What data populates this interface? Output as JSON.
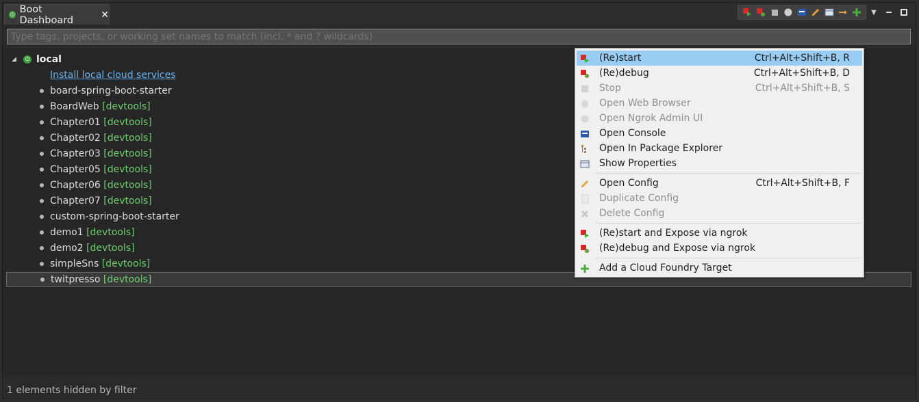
{
  "tab": {
    "title": "Boot Dashboard",
    "close": "✕"
  },
  "filter": {
    "placeholder": "Type tags, projects, or working set names to match (incl. * and ? wildcards)"
  },
  "tree": {
    "root": "local",
    "install_link": "Install local cloud services",
    "items": [
      {
        "name": "board-spring-boot-starter",
        "tag": ""
      },
      {
        "name": "BoardWeb",
        "tag": "[devtools]"
      },
      {
        "name": "Chapter01",
        "tag": "[devtools]"
      },
      {
        "name": "Chapter02",
        "tag": "[devtools]"
      },
      {
        "name": "Chapter03",
        "tag": "[devtools]"
      },
      {
        "name": "Chapter05",
        "tag": "[devtools]"
      },
      {
        "name": "Chapter06",
        "tag": "[devtools]"
      },
      {
        "name": "Chapter07",
        "tag": "[devtools]"
      },
      {
        "name": "custom-spring-boot-starter",
        "tag": ""
      },
      {
        "name": "demo1",
        "tag": "[devtools]"
      },
      {
        "name": "demo2",
        "tag": "[devtools]"
      },
      {
        "name": "simpleSns",
        "tag": "[devtools]"
      },
      {
        "name": "twitpresso",
        "tag": "[devtools]"
      }
    ]
  },
  "status": "1 elements hidden by filter",
  "menu": {
    "items": [
      {
        "label": "(Re)start",
        "shortcut": "Ctrl+Alt+Shift+B, R",
        "icon": "restart-icon",
        "enabled": true,
        "highlighted": true
      },
      {
        "label": "(Re)debug",
        "shortcut": "Ctrl+Alt+Shift+B, D",
        "icon": "redebug-icon",
        "enabled": true
      },
      {
        "label": "Stop",
        "shortcut": "Ctrl+Alt+Shift+B, S",
        "icon": "stop-icon",
        "enabled": false
      },
      {
        "label": "Open Web Browser",
        "shortcut": "",
        "icon": "browser-icon",
        "enabled": false
      },
      {
        "label": "Open Ngrok Admin UI",
        "shortcut": "",
        "icon": "ngrok-icon",
        "enabled": false
      },
      {
        "label": "Open Console",
        "shortcut": "",
        "icon": "console-icon",
        "enabled": true
      },
      {
        "label": "Open In Package Explorer",
        "shortcut": "",
        "icon": "package-explorer-icon",
        "enabled": true
      },
      {
        "label": "Show Properties",
        "shortcut": "",
        "icon": "properties-icon",
        "enabled": true
      },
      {
        "label": "Open Config",
        "shortcut": "Ctrl+Alt+Shift+B, F",
        "icon": "pencil-icon",
        "enabled": true
      },
      {
        "label": "Duplicate Config",
        "shortcut": "",
        "icon": "duplicate-icon",
        "enabled": false
      },
      {
        "label": "Delete Config",
        "shortcut": "",
        "icon": "delete-icon",
        "enabled": false
      },
      {
        "label": "(Re)start and Expose via ngrok",
        "shortcut": "",
        "icon": "restart-ngrok-icon",
        "enabled": true
      },
      {
        "label": "(Re)debug and Expose via ngrok",
        "shortcut": "",
        "icon": "redebug-ngrok-icon",
        "enabled": true
      },
      {
        "label": "Add a Cloud Foundry Target",
        "shortcut": "",
        "icon": "add-target-icon",
        "enabled": true
      }
    ]
  },
  "colors": {
    "accent_green": "#3fa13f",
    "tag_green": "#6fce6f",
    "highlight": "#99ccf2",
    "link": "#6ab4f0"
  }
}
